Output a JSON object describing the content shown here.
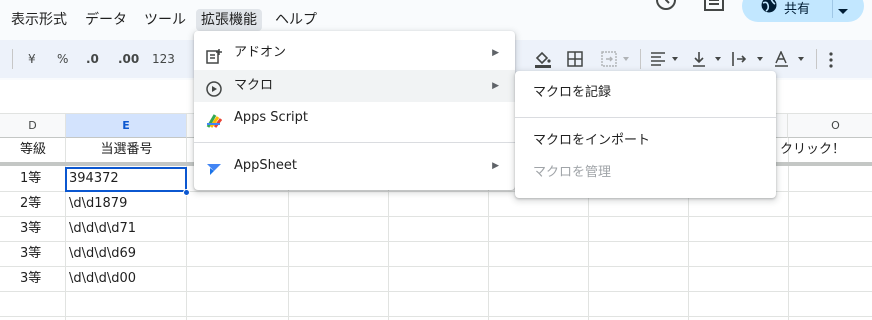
{
  "menubar": {
    "items": [
      "表示形式",
      "データ",
      "ツール",
      "拡張機能",
      "ヘルプ"
    ]
  },
  "header": {
    "history_icon": "history-icon",
    "comment_icon": "comment-icon",
    "share_label": "共有",
    "share_icon": "globe-icon"
  },
  "toolbar": {
    "currency": "¥",
    "percent": "%",
    "decrease_decimal": ".0",
    "increase_decimal": ".00",
    "number_format": "123"
  },
  "grid": {
    "columns": [
      "D",
      "E",
      "",
      "",
      "",
      "",
      "",
      "",
      "",
      "",
      "",
      "",
      "",
      "O"
    ],
    "selected_column": "E",
    "header_row": [
      "等級",
      "当選番号"
    ],
    "right_header_text": "クリック！",
    "rows": [
      [
        "1等",
        "394372"
      ],
      [
        "2等",
        "\\d\\d1879"
      ],
      [
        "3等",
        "\\d\\d\\d\\d71"
      ],
      [
        "3等",
        "\\d\\d\\d\\d69"
      ],
      [
        "3等",
        "\\d\\d\\d\\d00"
      ]
    ]
  },
  "extensions_menu": {
    "items": [
      {
        "label": "アドオン",
        "icon": "addon-icon",
        "has_submenu": true
      },
      {
        "label": "マクロ",
        "icon": "play-circle-icon",
        "has_submenu": true
      },
      {
        "label": "Apps Script",
        "icon": "apps-script-icon",
        "has_submenu": false
      },
      {
        "label": "AppSheet",
        "icon": "appsheet-icon",
        "has_submenu": true
      }
    ]
  },
  "macro_submenu": {
    "items": [
      {
        "label": "マクロを記録",
        "disabled": false
      },
      {
        "label": "マクロをインポート",
        "disabled": false
      },
      {
        "label": "マクロを管理",
        "disabled": true
      }
    ]
  },
  "colors": {
    "accent": "#0b57d0",
    "share_bg": "#c2e7ff",
    "toolbar_bg": "#edf2fa"
  }
}
